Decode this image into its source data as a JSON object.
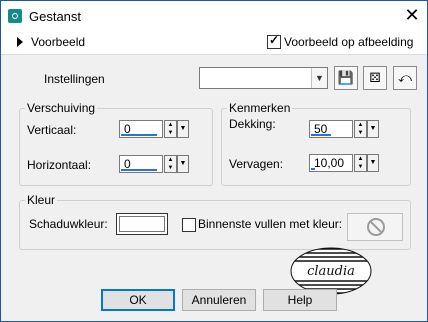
{
  "window": {
    "title": "Gestanst",
    "close_glyph": "✕"
  },
  "preview": {
    "label": "Voorbeeld",
    "image_preview_label": "Voorbeeld op afbeelding",
    "image_preview_checked": true
  },
  "settings": {
    "label": "Instellingen",
    "value": "",
    "icons": [
      "save-preset-icon",
      "random-preset-icon",
      "reset-preset-icon"
    ]
  },
  "offset": {
    "title": "Verschuiving",
    "vertical": {
      "label": "Verticaal:",
      "value": "0",
      "fill": 0.9
    },
    "horizontal": {
      "label": "Horizontaal:",
      "value": "0",
      "fill": 0.9
    }
  },
  "properties": {
    "title": "Kenmerken",
    "opacity": {
      "label": "Dekking:",
      "value": "50",
      "fill": 0.5
    },
    "blur": {
      "label": "Vervagen:",
      "value": "10,00",
      "fill": 0.1
    }
  },
  "color": {
    "title": "Kleur",
    "shadow_label": "Schaduwkleur:",
    "shadow_color": "#ffffff",
    "fill_inside_label": "Binnenste vullen met kleur:",
    "fill_inside_checked": false
  },
  "watermark": {
    "text": "claudia"
  },
  "buttons": {
    "ok": "OK",
    "cancel": "Annuleren",
    "help": "Help"
  },
  "colors": {
    "accent": "#2a74d4",
    "border": "#1c57a8",
    "app_icon": "#168a8a"
  }
}
